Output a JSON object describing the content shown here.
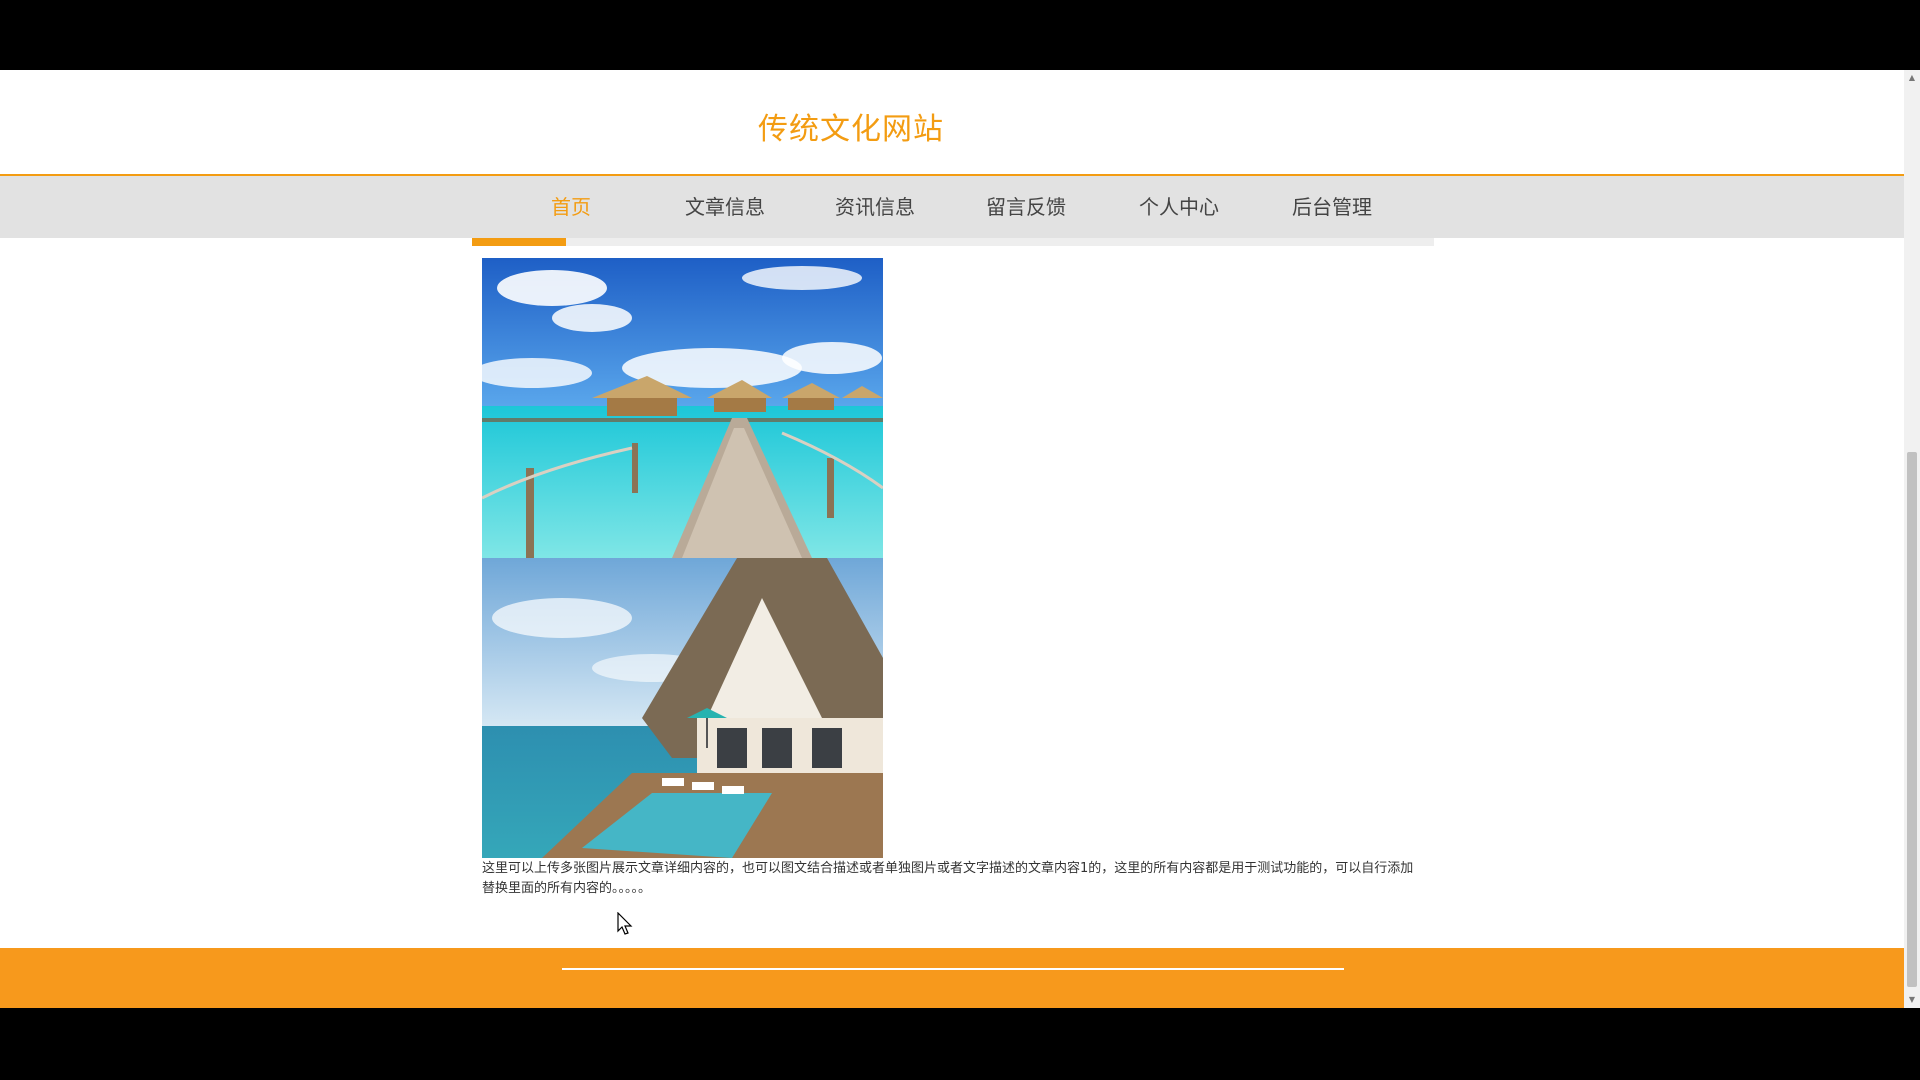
{
  "site": {
    "title": "传统文化网站"
  },
  "nav": {
    "items": [
      {
        "label": "首页",
        "active": true
      },
      {
        "label": "文章信息",
        "active": false
      },
      {
        "label": "资讯信息",
        "active": false
      },
      {
        "label": "留言反馈",
        "active": false
      },
      {
        "label": "个人中心",
        "active": false
      },
      {
        "label": "后台管理",
        "active": false
      }
    ]
  },
  "article": {
    "text": "这里可以上传多张图片展示文章详细内容的，也可以图文结合描述或者单独图片或者文字描述的文章内容1的，这里的所有内容都是用于测试功能的，可以自行添加替换里面的所有内容的。。。。。"
  },
  "colors": {
    "accent": "#f39c12",
    "footer": "#f7991c",
    "nav_bg": "#e2e2e2"
  },
  "scrollbar": {
    "position_fraction": 0.62
  }
}
